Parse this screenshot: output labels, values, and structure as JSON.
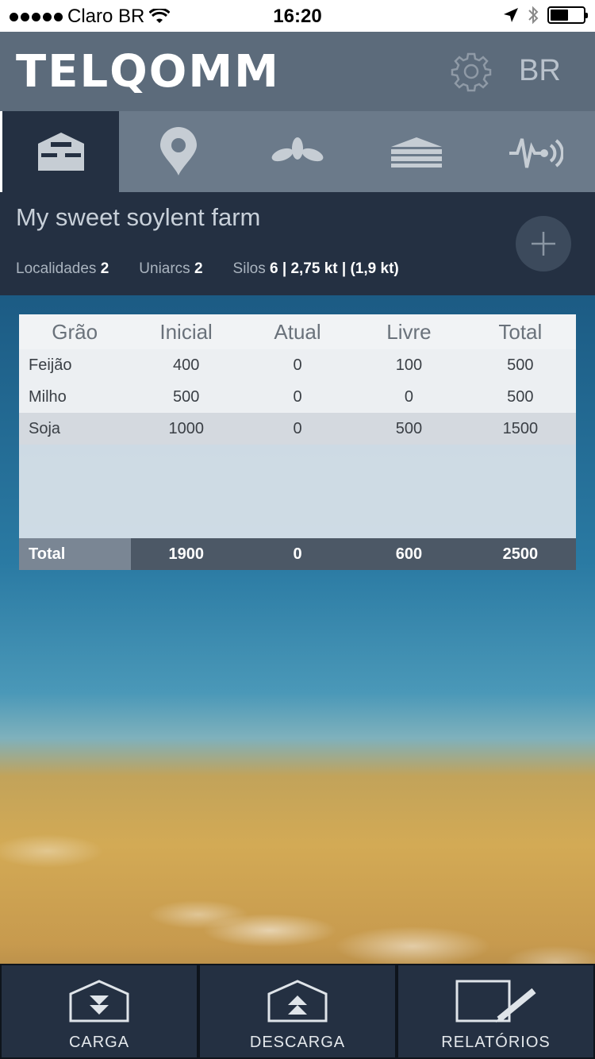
{
  "status_bar": {
    "carrier": "Claro BR",
    "time": "16:20",
    "battery_level": 0.55
  },
  "header": {
    "logo": "TELQOMM",
    "settings_icon": "gear-icon",
    "language": "BR"
  },
  "tabs": [
    {
      "icon": "barn-icon",
      "active": true
    },
    {
      "icon": "location-pin-icon",
      "active": false
    },
    {
      "icon": "leaves-icon",
      "active": false
    },
    {
      "icon": "silo-icon",
      "active": false
    },
    {
      "icon": "sensor-signal-icon",
      "active": false
    }
  ],
  "farm": {
    "title": "My sweet soylent farm",
    "localidades_label": "Localidades",
    "localidades_value": "2",
    "uniarcs_label": "Uniarcs",
    "uniarcs_value": "2",
    "silos_label": "Silos",
    "silos_value": "6 | 2,75 kt | (1,9 kt)"
  },
  "table": {
    "headers": [
      "Grão",
      "Inicial",
      "Atual",
      "Livre",
      "Total"
    ],
    "rows": [
      [
        "Feijão",
        "400",
        "0",
        "100",
        "500"
      ],
      [
        "Milho",
        "500",
        "0",
        "0",
        "500"
      ],
      [
        "Soja",
        "1000",
        "0",
        "500",
        "1500"
      ]
    ],
    "total": [
      "Total",
      "1900",
      "0",
      "600",
      "2500"
    ]
  },
  "bottom_buttons": [
    {
      "label": "CARGA",
      "icon": "load-down-icon"
    },
    {
      "label": "DESCARGA",
      "icon": "unload-up-icon"
    },
    {
      "label": "RELATÓRIOS",
      "icon": "report-edit-icon"
    }
  ]
}
